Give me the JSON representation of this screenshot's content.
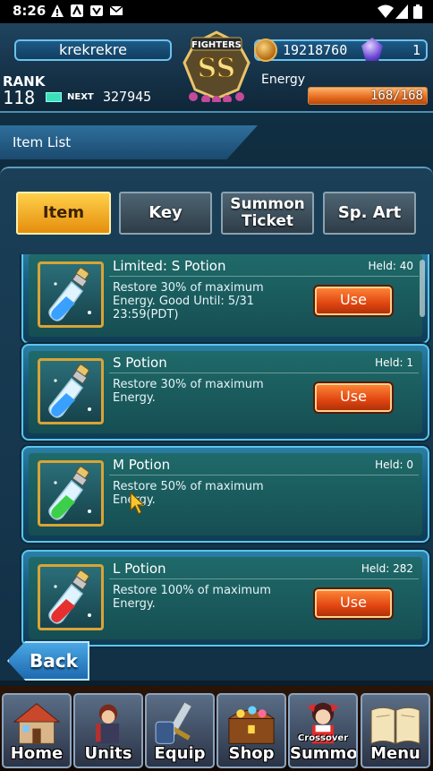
{
  "status_bar": {
    "time": "8:26"
  },
  "header": {
    "player_name": "krekrekre",
    "gold": "19218760",
    "gems": "1",
    "rank_label": "RANK",
    "rank": "118",
    "next_label": "NEXT",
    "next_value": "327945",
    "energy_label": "Energy",
    "energy_value": "168/168",
    "energy_fraction": 1.0,
    "logo_top": "FIGHTERS",
    "logo_rank": "SS"
  },
  "page_title": "Item List",
  "tabs": [
    {
      "label_line1": "Item",
      "label_line2": "",
      "active": true
    },
    {
      "label_line1": "Key",
      "label_line2": "",
      "active": false
    },
    {
      "label_line1": "Summon",
      "label_line2": "Ticket",
      "active": false
    },
    {
      "label_line1": "Sp. Art",
      "label_line2": "",
      "active": false
    }
  ],
  "items": [
    {
      "name": "Limited: S Potion",
      "held": "Held: 40",
      "desc": "Restore 30% of maximum Energy. Good Until: 5/31 23:59(PDT)",
      "use_label": "Use",
      "has_use": true,
      "color": "#3aa0ff"
    },
    {
      "name": "S Potion",
      "held": "Held: 1",
      "desc": "Restore 30% of maximum Energy.",
      "use_label": "Use",
      "has_use": true,
      "color": "#3aa0ff"
    },
    {
      "name": "M Potion",
      "held": "Held: 0",
      "desc": "Restore 50% of maximum Energy.",
      "use_label": "",
      "has_use": false,
      "color": "#3cd04a"
    },
    {
      "name": "L Potion",
      "held": "Held: 282",
      "desc": "Restore 100% of maximum Energy.",
      "use_label": "Use",
      "has_use": true,
      "color": "#e63030"
    }
  ],
  "back_label": "Back",
  "nav": [
    {
      "label": "Home",
      "sub": "",
      "icon": "house-icon"
    },
    {
      "label": "Units",
      "sub": "",
      "icon": "warrior-icon"
    },
    {
      "label": "Equip",
      "sub": "",
      "icon": "sword-icon"
    },
    {
      "label": "Shop",
      "sub": "",
      "icon": "treasure-chest-icon"
    },
    {
      "label": "Summon",
      "sub": "Crossover",
      "icon": "shrine-maiden-icon"
    },
    {
      "label": "Menu",
      "sub": "",
      "icon": "book-icon"
    }
  ]
}
